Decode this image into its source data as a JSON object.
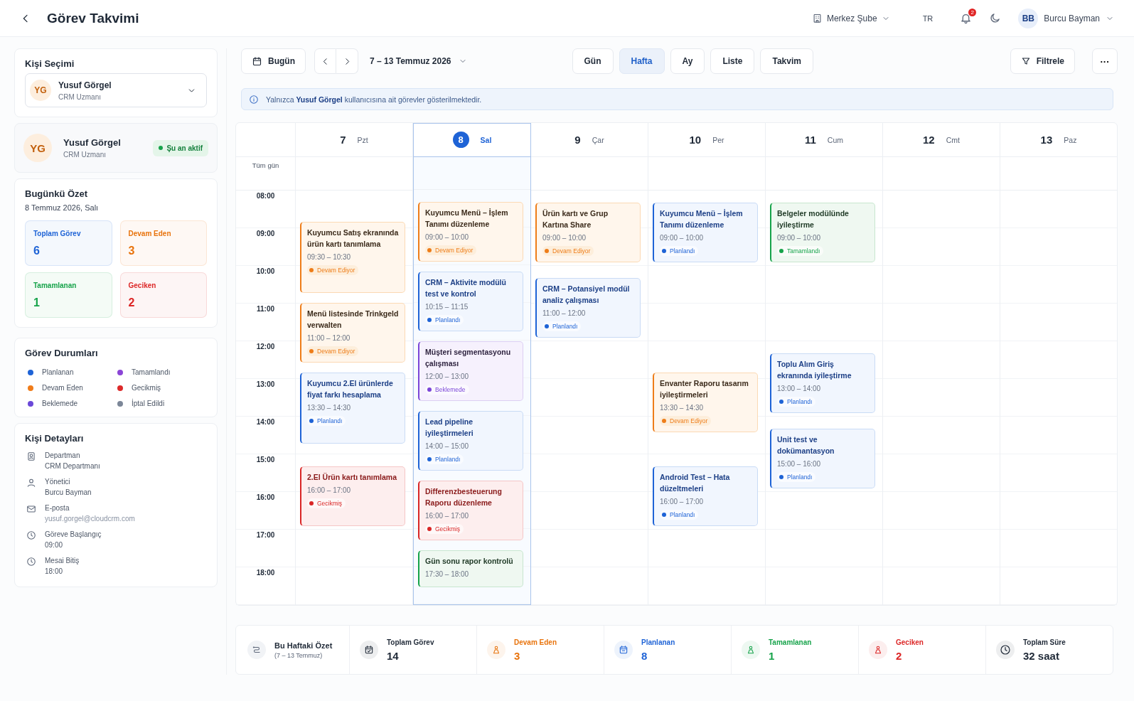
{
  "header": {
    "title": "Görev Takvimi",
    "branch": "Merkez Şube",
    "language": "TR",
    "notifications": "2",
    "user": {
      "initials": "BB",
      "name": "Burcu Bayman"
    }
  },
  "sidebar": {
    "person_select": {
      "label": "Kişi Seçimi",
      "initials": "YG",
      "name": "Yusuf Görgel",
      "role": "CRM Uzmanı"
    },
    "profile": {
      "initials": "YG",
      "name": "Yusuf Görgel",
      "role": "CRM Uzmanı",
      "status": "Şu an aktif"
    },
    "today": {
      "title": "Bugünkü Özet",
      "date": "8 Temmuz 2026, Salı",
      "cards": [
        {
          "label": "Toplam Görev",
          "value": "6",
          "color": "#1e63d6"
        },
        {
          "label": "Devam Eden",
          "value": "3",
          "color": "#e8730c"
        },
        {
          "label": "Tamamlanan",
          "value": "1",
          "color": "#16a34a"
        },
        {
          "label": "Geciken",
          "value": "2",
          "color": "#dc2626"
        }
      ]
    },
    "legend": {
      "title": "Görev Durumları",
      "items": [
        {
          "label": "Planlanan",
          "color": "#1e63d6"
        },
        {
          "label": "Tamamlandı",
          "color": "#8b45d6"
        },
        {
          "label": "Devam Eden",
          "color": "#f07c1a"
        },
        {
          "label": "Gecikmiş",
          "color": "#dc2a2a"
        },
        {
          "label": "Beklemede",
          "color": "#6a48d8"
        },
        {
          "label": "İptal Edildi",
          "color": "#7c8798"
        }
      ]
    },
    "details": {
      "title": "Kişi Detayları",
      "items": [
        {
          "kind": "department",
          "label": "Departman",
          "value": "CRM Departmanı"
        },
        {
          "kind": "manager",
          "label": "Yönetici",
          "value": "Burcu Bayman"
        },
        {
          "kind": "email",
          "label": "E-posta",
          "value": "yusuf.gorgel@cloudcrm.com"
        },
        {
          "kind": "start",
          "label": "Göreve Başlangıç",
          "value": "09:00"
        },
        {
          "kind": "end",
          "label": "Mesai Bitiş",
          "value": "18:00"
        }
      ]
    }
  },
  "toolbar": {
    "today": "Bugün",
    "range": "7 – 13 Temmuz 2026",
    "views": [
      {
        "label": "Gün",
        "selected": false
      },
      {
        "label": "Hafta",
        "selected": true
      },
      {
        "label": "Ay",
        "selected": false
      },
      {
        "label": "Liste",
        "selected": false
      },
      {
        "label": "Takvim",
        "selected": false
      }
    ],
    "filter": "Filtrele",
    "more": "···"
  },
  "info": "Yalnızca **Yusuf Görgel** kullanıcısına ait görevler gösterilmektedir.",
  "calendar": {
    "all_day": "Tüm gün",
    "hours": [
      "08:00",
      "09:00",
      "10:00",
      "11:00",
      "12:00",
      "13:00",
      "14:00",
      "15:00",
      "16:00",
      "17:00",
      "18:00"
    ],
    "days": [
      {
        "number": "7",
        "name": "Pzt",
        "selected": false,
        "events": [
          {
            "title": "Kuyumcu Satış ekranında ürün kartı tanımlama",
            "time": "09:30 – 10:30",
            "kind": "in_progress",
            "status": "Devam Ediyor"
          },
          {
            "title": "Menü listesinde Trinkgeld verwalten",
            "time": "11:00 – 12:00",
            "kind": "in_progress",
            "status": "Devam Ediyor"
          },
          {
            "title": "Kuyumcu 2.El ürünlerde fiyat farkı hesaplama",
            "time": "13:30 – 14:30",
            "kind": "planned",
            "status": "Planlandı"
          },
          {
            "title": "2.El Ürün kartı tanımlama",
            "time": "16:00 – 17:00",
            "kind": "late",
            "status": "Gecikmiş"
          }
        ]
      },
      {
        "number": "8",
        "name": "Sal",
        "selected": true,
        "events": [
          {
            "title": "Kuyumcu Menü – İşlem Tanımı düzenleme",
            "time": "09:00 – 10:00",
            "kind": "in_progress",
            "status": "Devam Ediyor"
          },
          {
            "title": "CRM – Aktivite modülü test ve kontrol",
            "time": "10:15 – 11:15",
            "kind": "planned",
            "status": "Planlandı"
          },
          {
            "title": "Müşteri segmentasyonu çalışması",
            "time": "12:00 – 13:00",
            "kind": "waiting",
            "status": "Beklemede"
          },
          {
            "title": "Lead pipeline iyileştirmeleri",
            "time": "14:00 – 15:00",
            "kind": "planned",
            "status": "Planlandı"
          },
          {
            "title": "Differenzbesteuerung Raporu düzenleme",
            "time": "16:00 – 17:00",
            "kind": "late",
            "status": "Gecikmiş"
          },
          {
            "title": "Gün sonu rapor kontrolü",
            "time": "17:30 – 18:00",
            "kind": "done"
          }
        ]
      },
      {
        "number": "9",
        "name": "Çar",
        "selected": false,
        "events": [
          {
            "title": "Ürün kartı ve Grup Kartına Share",
            "time": "09:00 – 10:00",
            "kind": "in_progress",
            "status": "Devam Ediyor"
          },
          {
            "title": "CRM – Potansiyel modül analiz çalışması",
            "time": "11:00 – 12:00",
            "kind": "planned",
            "status": "Planlandı"
          }
        ]
      },
      {
        "number": "10",
        "name": "Per",
        "selected": false,
        "events": [
          {
            "title": "Kuyumcu Menü – İşlem Tanımı düzenleme",
            "time": "09:00 – 10:00",
            "kind": "planned",
            "status": "Planlandı"
          },
          {
            "title": "Envanter Raporu tasarım iyileştirmeleri",
            "time": "13:30 – 14:30",
            "kind": "in_progress",
            "status": "Devam Ediyor"
          },
          {
            "title": "Android Test – Hata düzeltmeleri",
            "time": "16:00 – 17:00",
            "kind": "planned",
            "status": "Planlandı"
          }
        ]
      },
      {
        "number": "11",
        "name": "Cum",
        "selected": false,
        "events": [
          {
            "title": "Belgeler modülünde iyileştirme",
            "time": "09:00 – 10:00",
            "kind": "done",
            "status": "Tamamlandı"
          },
          {
            "title": "Toplu Alım Giriş ekranında iyileştirme",
            "time": "13:00 – 14:00",
            "kind": "planned",
            "status": "Planlandı"
          },
          {
            "title": "Unit test ve dokümantasyon",
            "time": "15:00 – 16:00",
            "kind": "planned",
            "status": "Planlandı"
          }
        ]
      },
      {
        "number": "12",
        "name": "Cmt",
        "selected": false
      },
      {
        "number": "13",
        "name": "Paz",
        "selected": false
      }
    ]
  },
  "weekly_summary": {
    "title": "Bu Haftaki Özet",
    "subtitle": "(7 – 13 Temmuz)",
    "stats": [
      {
        "kind": "total",
        "label": "Toplam Görev",
        "value": "14",
        "color": "#1f2937"
      },
      {
        "kind": "in_progress",
        "label": "Devam Eden",
        "value": "3",
        "color": "#e8730c"
      },
      {
        "kind": "planned",
        "label": "Planlanan",
        "value": "8",
        "color": "#1e63d6"
      },
      {
        "kind": "done",
        "label": "Tamamlanan",
        "value": "1",
        "color": "#16a34a"
      },
      {
        "kind": "late",
        "label": "Geciken",
        "value": "2",
        "color": "#dc2626"
      },
      {
        "kind": "duration",
        "label": "Toplam Süre",
        "value": "32 saat",
        "color": "#1f2937"
      }
    ]
  }
}
